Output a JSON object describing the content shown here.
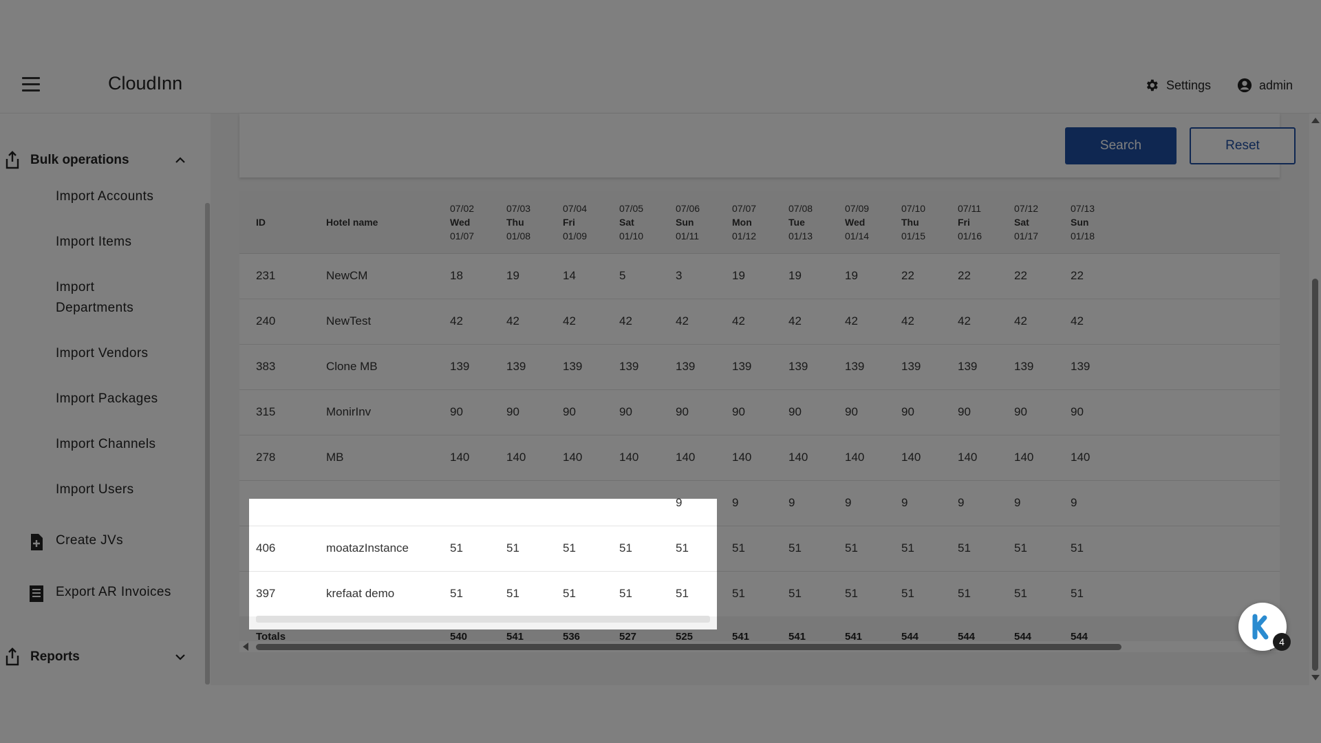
{
  "app": {
    "title": "CloudInn"
  },
  "header": {
    "settings_label": "Settings",
    "user_label": "admin"
  },
  "sidebar": {
    "bulk_label": "Bulk operations",
    "items": [
      "Import Accounts",
      "Import Items",
      "Import Departments",
      "Import Vendors",
      "Import Packages",
      "Import Channels",
      "Import Users"
    ],
    "create_jvs": "Create JVs",
    "export_ar": "Export AR Invoices",
    "reports_label": "Reports"
  },
  "filters": {
    "search_label": "Search",
    "reset_label": "Reset"
  },
  "table": {
    "id_header": "ID",
    "hotel_header": "Hotel name",
    "columns": [
      {
        "date": "07/02",
        "day": "Wed",
        "alt": "01/07"
      },
      {
        "date": "07/03",
        "day": "Thu",
        "alt": "01/08"
      },
      {
        "date": "07/04",
        "day": "Fri",
        "alt": "01/09"
      },
      {
        "date": "07/05",
        "day": "Sat",
        "alt": "01/10"
      },
      {
        "date": "07/06",
        "day": "Sun",
        "alt": "01/11"
      },
      {
        "date": "07/07",
        "day": "Mon",
        "alt": "01/12"
      },
      {
        "date": "07/08",
        "day": "Tue",
        "alt": "01/13"
      },
      {
        "date": "07/09",
        "day": "Wed",
        "alt": "01/14"
      },
      {
        "date": "07/10",
        "day": "Thu",
        "alt": "01/15"
      },
      {
        "date": "07/11",
        "day": "Fri",
        "alt": "01/16"
      },
      {
        "date": "07/12",
        "day": "Sat",
        "alt": "01/17"
      },
      {
        "date": "07/13",
        "day": "Sun",
        "alt": "01/18"
      }
    ],
    "rows": [
      {
        "id": "231",
        "name": "NewCM",
        "values": [
          "18",
          "19",
          "14",
          "5",
          "3",
          "19",
          "19",
          "19",
          "22",
          "22",
          "22",
          "22"
        ]
      },
      {
        "id": "240",
        "name": "NewTest",
        "values": [
          "42",
          "42",
          "42",
          "42",
          "42",
          "42",
          "42",
          "42",
          "42",
          "42",
          "42",
          "42"
        ]
      },
      {
        "id": "383",
        "name": "Clone MB",
        "values": [
          "139",
          "139",
          "139",
          "139",
          "139",
          "139",
          "139",
          "139",
          "139",
          "139",
          "139",
          "139"
        ]
      },
      {
        "id": "315",
        "name": "MonirInv",
        "values": [
          "90",
          "90",
          "90",
          "90",
          "90",
          "90",
          "90",
          "90",
          "90",
          "90",
          "90",
          "90"
        ]
      },
      {
        "id": "278",
        "name": "MB",
        "values": [
          "140",
          "140",
          "140",
          "140",
          "140",
          "140",
          "140",
          "140",
          "140",
          "140",
          "140",
          "140"
        ]
      },
      {
        "id": "",
        "name": "",
        "values": [
          "",
          "",
          "",
          "",
          "9",
          "9",
          "9",
          "9",
          "9",
          "9",
          "9",
          "9"
        ]
      },
      {
        "id": "406",
        "name": "moatazInstance",
        "values": [
          "51",
          "51",
          "51",
          "51",
          "51",
          "51",
          "51",
          "51",
          "51",
          "51",
          "51",
          "51"
        ]
      },
      {
        "id": "397",
        "name": "krefaat demo",
        "values": [
          "51",
          "51",
          "51",
          "51",
          "51",
          "51",
          "51",
          "51",
          "51",
          "51",
          "51",
          "51"
        ]
      }
    ],
    "totals_label": "Totals",
    "totals": [
      "540",
      "541",
      "536",
      "527",
      "525",
      "541",
      "541",
      "541",
      "544",
      "544",
      "544",
      "544"
    ]
  },
  "chat": {
    "badge": "4"
  },
  "colors": {
    "primary": "#1f4fa3",
    "overlay": "rgba(0,0,0,0.5)"
  }
}
